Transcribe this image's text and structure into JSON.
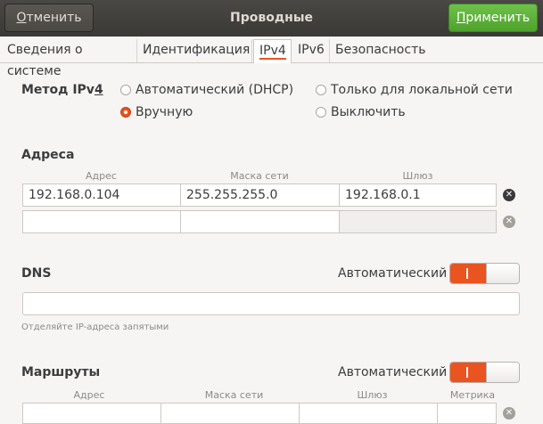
{
  "header": {
    "title": "Проводные",
    "cancel_mnemonic": "О",
    "cancel_rest": "тменить",
    "apply_mnemonic": "П",
    "apply_rest": "рименить"
  },
  "tabs": [
    {
      "label": "Сведения о системе",
      "active": false
    },
    {
      "label": "Идентификация",
      "active": false
    },
    {
      "label": "IPv4",
      "active": true
    },
    {
      "label": "IPv6",
      "active": false
    },
    {
      "label": "Безопасность",
      "active": false
    }
  ],
  "method": {
    "label_prefix": "Метод IPv",
    "label_mnemonic": "4",
    "options": [
      {
        "label": "Автоматический (DHCP)",
        "checked": false
      },
      {
        "label": "Только для локальной сети",
        "checked": false
      },
      {
        "label": "Вручную",
        "checked": true
      },
      {
        "label": "Выключить",
        "checked": false
      }
    ]
  },
  "addresses": {
    "title": "Адреса",
    "columns": [
      "Адрес",
      "Маска сети",
      "Шлюз"
    ],
    "rows": [
      {
        "address": "192.168.0.104",
        "netmask": "255.255.255.0",
        "gateway": "192.168.0.1"
      },
      {
        "address": "",
        "netmask": "",
        "gateway": ""
      }
    ]
  },
  "dns": {
    "title": "DNS",
    "auto_label": "Автоматический",
    "auto_enabled": true,
    "value": "",
    "hint": "Отделяйте IP-адреса запятыми"
  },
  "routes": {
    "title": "Маршруты",
    "auto_label": "Автоматический",
    "auto_enabled": true,
    "columns": [
      "Адрес",
      "Маска сети",
      "Шлюз",
      "Метрика"
    ],
    "rows": [
      {
        "address": "",
        "netmask": "",
        "gateway": "",
        "metric": ""
      }
    ]
  },
  "icons": {
    "clear": "✕"
  },
  "colors": {
    "accent": "#e95420",
    "apply": "#5cb536",
    "header": "#3f3d39"
  }
}
